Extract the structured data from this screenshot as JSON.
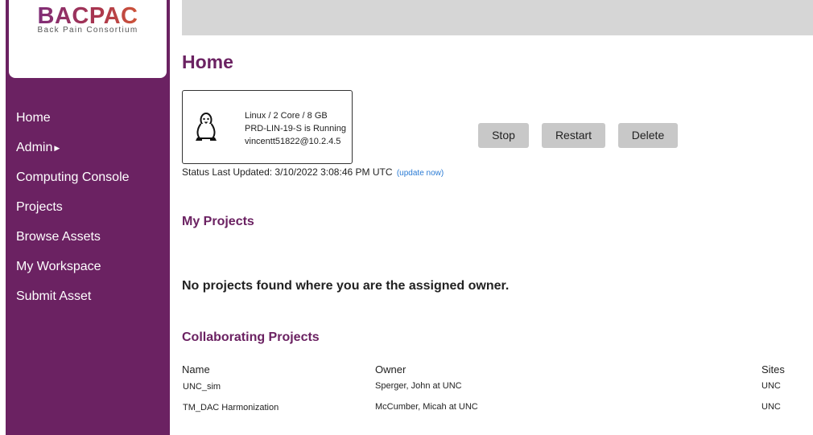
{
  "brand": {
    "name": "BACPAC",
    "tagline": "Back Pain Consortium"
  },
  "nav": {
    "items": [
      "Home",
      "Admin",
      "Computing Console",
      "Projects",
      "Browse Assets",
      "My Workspace",
      "Submit Asset"
    ]
  },
  "page": {
    "title": "Home"
  },
  "vm": {
    "specs": "Linux / 2 Core / 8 GB",
    "status": "PRD-LIN-19-S is Running",
    "user": "vincentt51822@10.2.4.5",
    "icon": "linux-tux-icon"
  },
  "actions": {
    "stop": "Stop",
    "restart": "Restart",
    "delete": "Delete"
  },
  "status": {
    "text": "Status Last Updated: 3/10/2022 3:08:46 PM UTC",
    "update_link": "(update now)"
  },
  "my_projects": {
    "title": "My Projects",
    "empty_message": "No projects found where you are the assigned owner."
  },
  "collab": {
    "title": "Collaborating Projects",
    "headers": {
      "name": "Name",
      "owner": "Owner",
      "sites": "Sites"
    },
    "rows": [
      {
        "name": "UNC_sim",
        "owner": "Sperger, John at UNC",
        "sites": "UNC"
      },
      {
        "name": "TM_DAC Harmonization",
        "owner": "McCumber, Micah at UNC",
        "sites": "UNC"
      }
    ]
  },
  "colors": {
    "brand_purple": "#6b2262",
    "topbar_gray": "#d6d6d6",
    "button_gray": "#c8c8c8",
    "link_blue": "#2a7bd4"
  }
}
